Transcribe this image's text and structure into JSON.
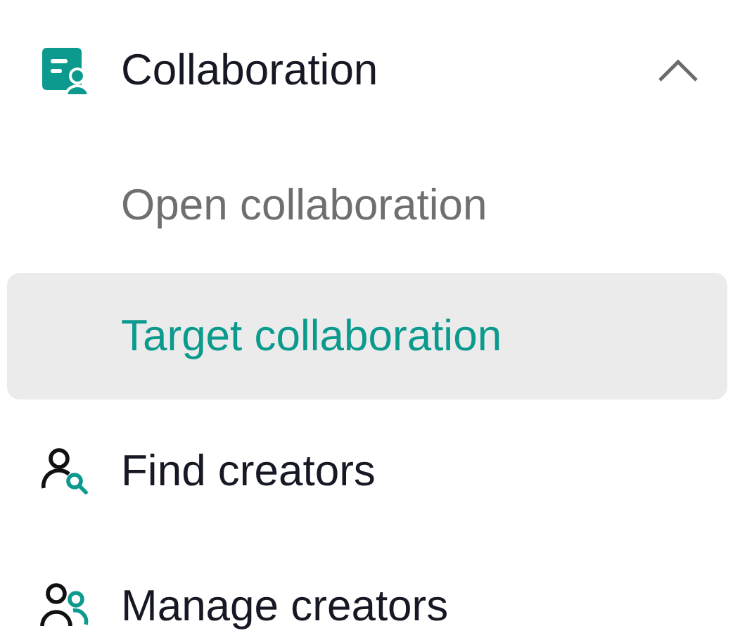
{
  "menu": {
    "label": "Collaboration",
    "expanded": true,
    "children": [
      {
        "label": "Open collaboration",
        "selected": false
      },
      {
        "label": "Target collaboration",
        "selected": true
      }
    ]
  },
  "items": [
    {
      "kind": "find",
      "label": "Find creators"
    },
    {
      "kind": "manage",
      "label": "Manage creators"
    }
  ]
}
